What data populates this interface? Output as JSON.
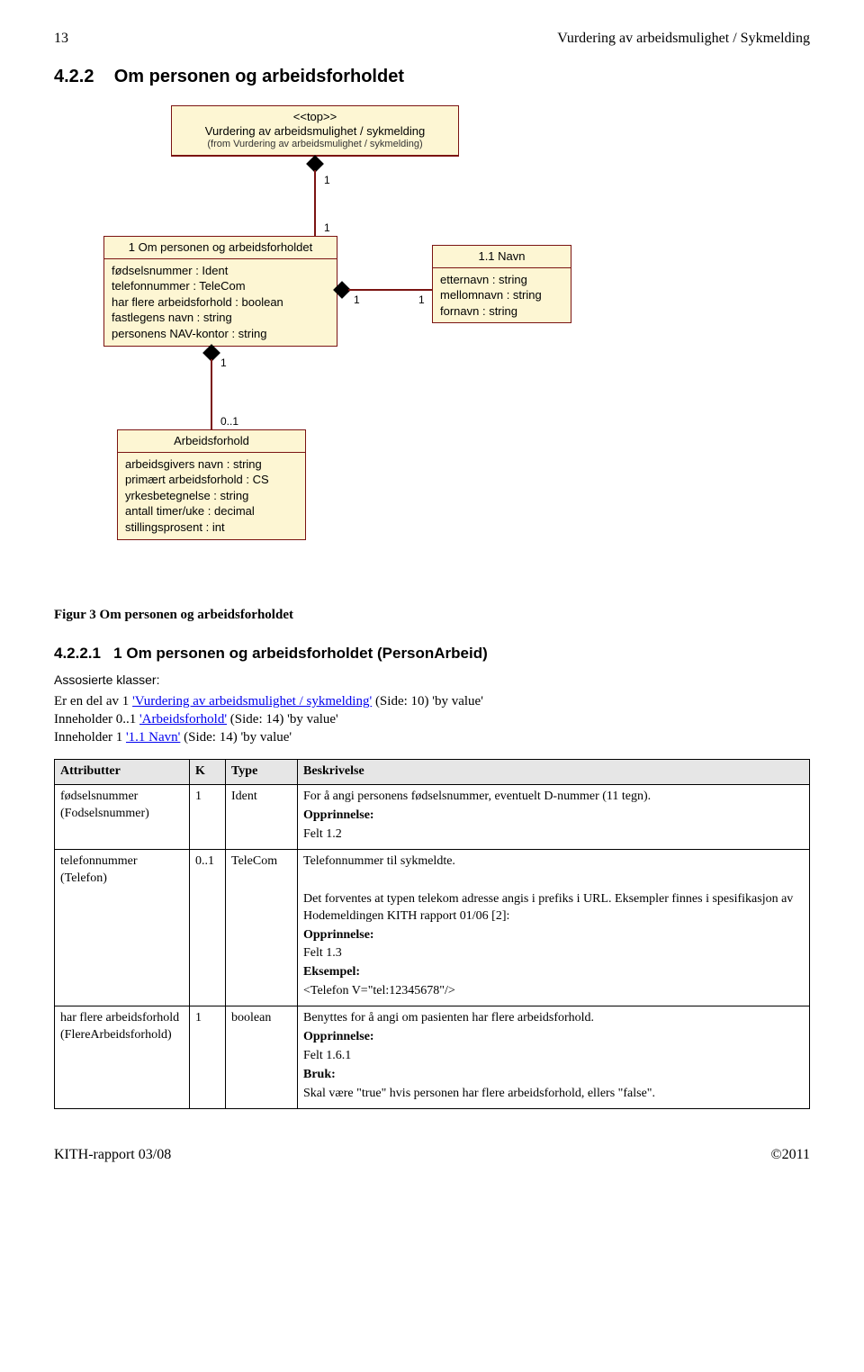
{
  "header": {
    "page_number": "13",
    "doc_title": "Vurdering av arbeidsmulighet / Sykmelding"
  },
  "section": {
    "number": "4.2.2",
    "title": "Om personen og arbeidsforholdet"
  },
  "uml": {
    "top": {
      "stereotype": "<<top>>",
      "name": "Vurdering av arbeidsmulighet / sykmelding",
      "from": "(from Vurdering av arbeidsmulighet / sykmelding)"
    },
    "person": {
      "name": "1 Om personen og arbeidsforholdet",
      "attrs": [
        "fødselsnummer : Ident",
        "telefonnummer : TeleCom",
        "har flere arbeidsforhold : boolean",
        "fastlegens navn : string",
        "personens NAV-kontor : string"
      ]
    },
    "navn": {
      "name": "1.1 Navn",
      "attrs": [
        "etternavn : string",
        "mellomnavn : string",
        "fornavn : string"
      ]
    },
    "arbeid": {
      "name": "Arbeidsforhold",
      "attrs": [
        "arbeidsgivers navn : string",
        "primært arbeidsforhold : CS",
        "yrkesbetegnelse : string",
        "antall timer/uke : decimal",
        "stillingsprosent : int"
      ]
    },
    "mult": {
      "top_to_person_top": "1",
      "top_to_person_bottom": "1",
      "person_to_arbeid_top": "1",
      "person_to_arbeid_bottom": "0..1",
      "person_to_navn_left": "1",
      "person_to_navn_right": "1"
    }
  },
  "fig_caption": "Figur 3 Om personen og arbeidsforholdet",
  "subsection": {
    "number": "4.2.2.1",
    "title": "1 Om personen og arbeidsforholdet (PersonArbeid)"
  },
  "assoc": {
    "heading": "Assosierte klasser:",
    "line1_pre": "Er en del av 1 ",
    "line1_link": "'Vurdering av arbeidsmulighet / sykmelding'",
    "line1_post": "  (Side: 10) 'by value'",
    "line2_pre": "Inneholder 0..1 ",
    "line2_link": "'Arbeidsforhold'",
    "line2_post": "  (Side: 14) 'by value'",
    "line3_pre": "Inneholder 1 ",
    "line3_link": "'1.1 Navn'",
    "line3_post": "  (Side: 14) 'by value'"
  },
  "table": {
    "headers": {
      "attr": "Attributter",
      "k": "K",
      "type": "Type",
      "desc": "Beskrivelse"
    },
    "rows": [
      {
        "attr_name": "fødselsnummer",
        "attr_tech": "(Fodselsnummer)",
        "k": "1",
        "type": "Ident",
        "desc_main": "For å angi personens fødselsnummer, eventuelt D-nummer (11 tegn).",
        "origin_label": "Opprinnelse:",
        "origin_val": "Felt 1.2"
      },
      {
        "attr_name": "telefonnummer",
        "attr_tech": "(Telefon)",
        "k": "0..1",
        "type": "TeleCom",
        "desc_main": "Telefonnummer til sykmeldte.",
        "desc_extra": "Det forventes at typen telekom adresse angis i prefiks i URL. Eksempler finnes i spesifikasjon av Hodemeldingen KITH rapport 01/06 [2]:",
        "origin_label": "Opprinnelse:",
        "origin_val": "Felt 1.3",
        "example_label": "Eksempel:",
        "example_val": "<Telefon V=\"tel:12345678\"/>"
      },
      {
        "attr_name": "har flere arbeidsforhold",
        "attr_tech": "(FlereArbeidsforhold)",
        "k": "1",
        "type": "boolean",
        "desc_main": "Benyttes for å angi om pasienten har flere arbeidsforhold.",
        "origin_label": "Opprinnelse:",
        "origin_val": "Felt 1.6.1",
        "usage_label": "Bruk:",
        "usage_val": "Skal være \"true\" hvis personen har flere arbeidsforhold, ellers \"false\"."
      }
    ]
  },
  "footer": {
    "left": "KITH-rapport 03/08",
    "right": "©2011"
  }
}
